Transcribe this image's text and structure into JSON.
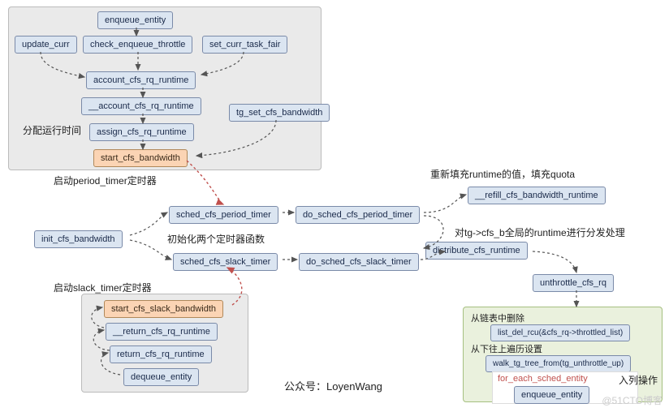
{
  "nodes": {
    "enqueue_entity": "enqueue_entity",
    "update_curr": "update_curr",
    "check_enqueue_throttle": "check_enqueue_throttle",
    "set_curr_task_fair": "set_curr_task_fair",
    "account_cfs_rq_runtime": "account_cfs_rq_runtime",
    "__account_cfs_rq_runtime": "__account_cfs_rq_runtime",
    "assign_cfs_rq_runtime": "assign_cfs_rq_runtime",
    "start_cfs_bandwidth": "start_cfs_bandwidth",
    "tg_set_cfs_bandwidth": "tg_set_cfs_bandwidth",
    "init_cfs_bandwidth": "init_cfs_bandwidth",
    "sched_cfs_period_timer": "sched_cfs_period_timer",
    "do_sched_cfs_period_timer": "do_sched_cfs_period_timer",
    "sched_cfs_slack_timer": "sched_cfs_slack_timer",
    "do_sched_cfs_slack_timer": "do_sched_cfs_slack_timer",
    "distribute_cfs_runtime": "distribute_cfs_runtime",
    "__refill_cfs_bandwidth_runtime": "__refill_cfs_bandwidth_runtime",
    "unthrottle_cfs_rq": "unthrottle_cfs_rq",
    "start_cfs_slack_bandwidth": "start_cfs_slack_bandwidth",
    "__return_cfs_rq_runtime": "__return_cfs_rq_runtime",
    "return_cfs_rq_runtime": "return_cfs_rq_runtime",
    "dequeue_entity": "dequeue_entity",
    "list_del_rcu": "list_del_rcu(&cfs_rq->throttled_list)",
    "walk_tg_tree_from": "walk_tg_tree_from(tg_unthrottle_up)",
    "for_each_sched_entity": "for_each_sched_entity",
    "enqueue_entity2": "enqueue_entity"
  },
  "labels": {
    "assign_runtime": "分配运行时间",
    "start_period_timer": "启动period_timer定时器",
    "init_two_timers": "初始化两个定时器函数",
    "start_slack_timer": "启动slack_timer定时器",
    "refill_desc": "重新填充runtime的值，填充quota",
    "distribute_desc": "对tg->cfs_b全局的runtime进行分发处理",
    "from_list_delete": "从链表中删除",
    "from_bottom_traverse": "从下往上遍历设置",
    "enqueue_op": "入列操作",
    "credit": "公众号：LoyenWang",
    "watermark": "@51CTO博客"
  }
}
